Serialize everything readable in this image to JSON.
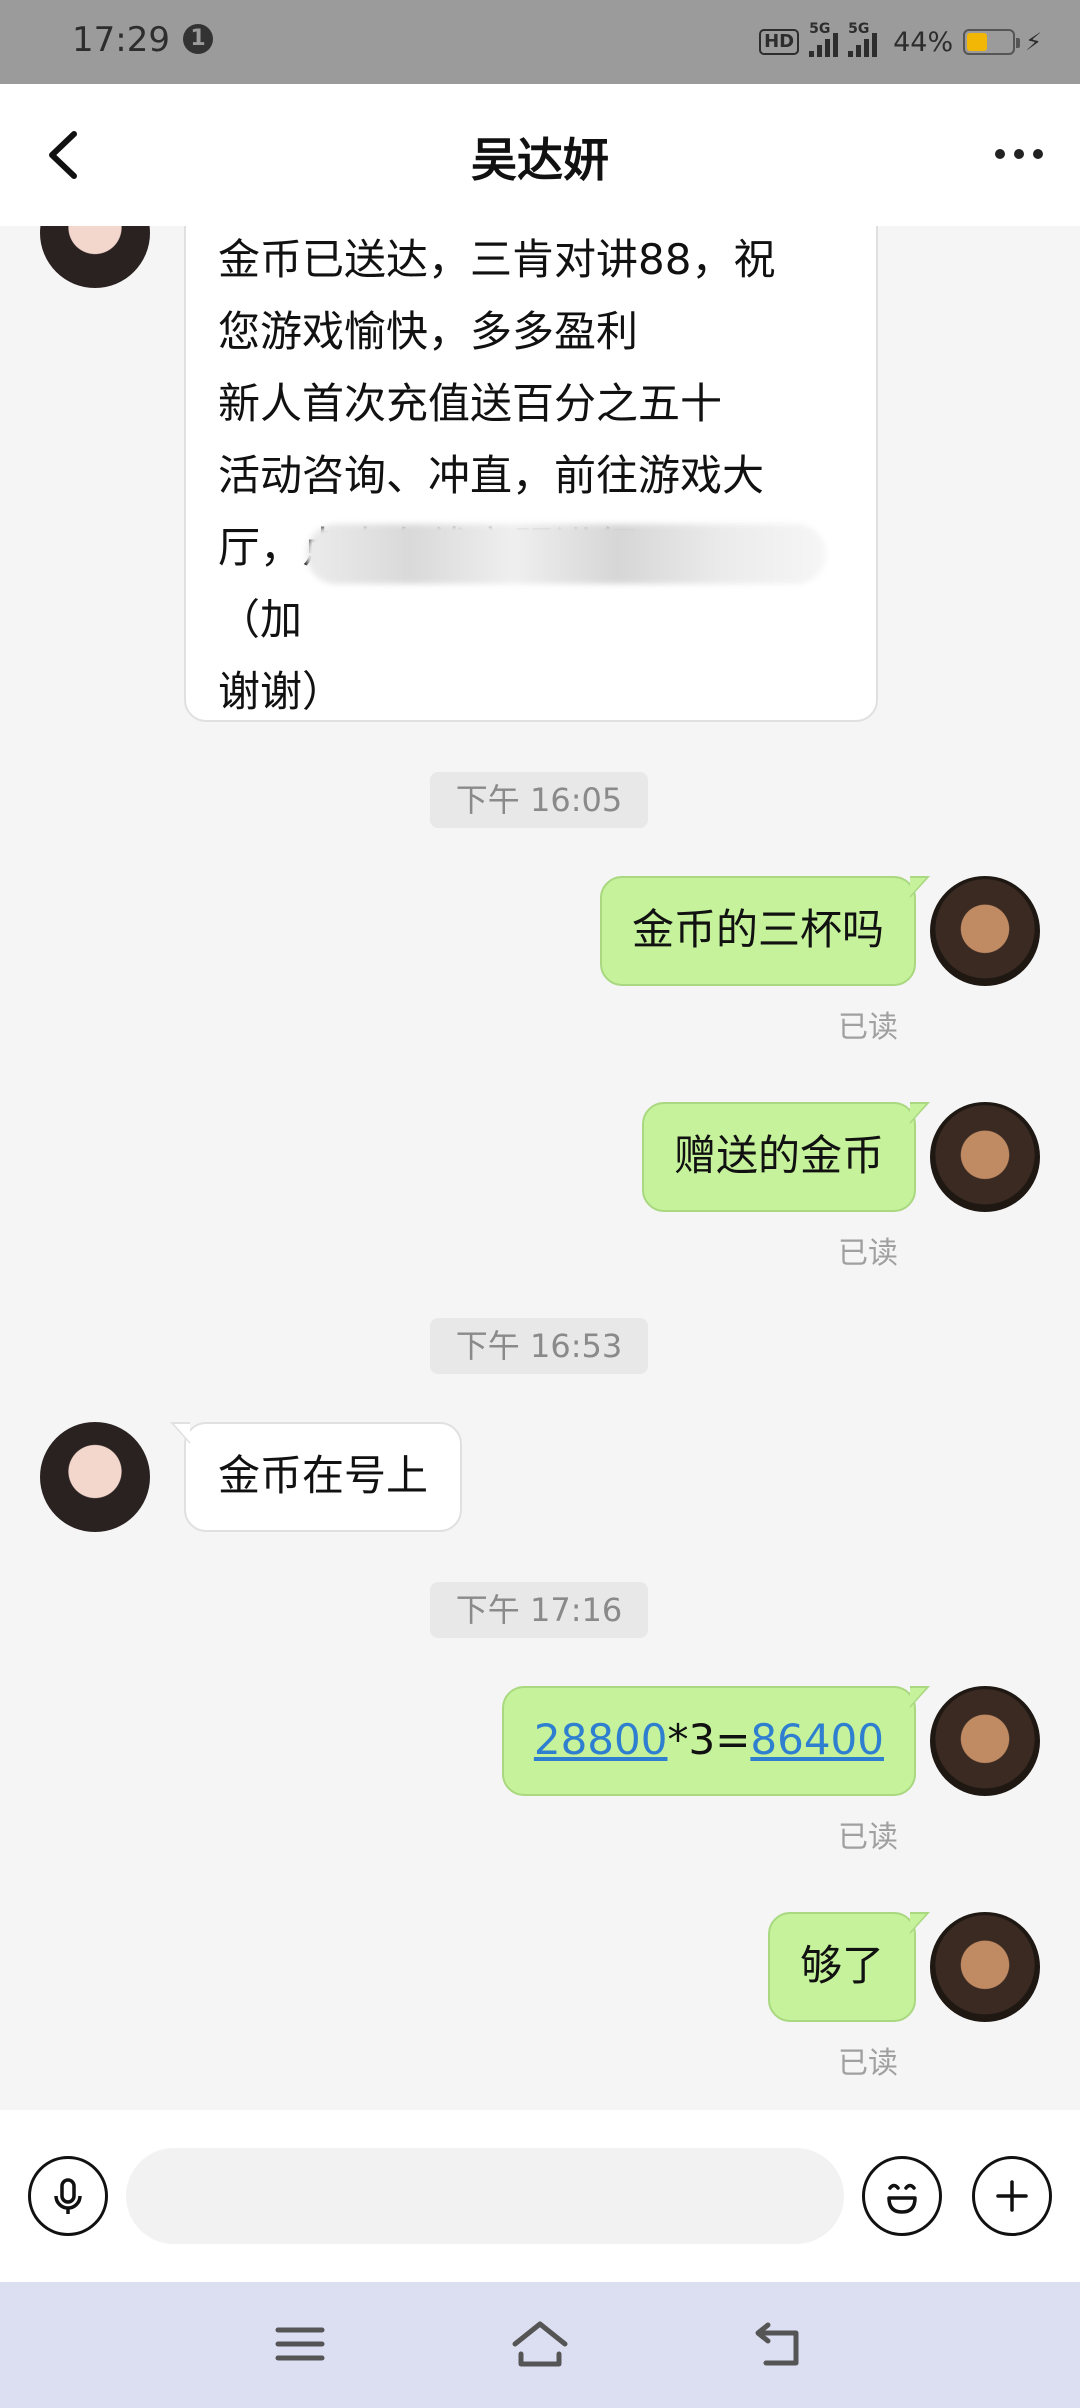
{
  "status_bar": {
    "time": "17:29",
    "notification_count": "1",
    "hd_label": "HD",
    "net1": "5G",
    "net2": "5G",
    "battery_percent": "44%",
    "battery_level": 0.44
  },
  "header": {
    "title": "吴达妍"
  },
  "messages": {
    "long_msg": {
      "lines": [
        "金币已送达，三肯对讲88，祝",
        "您游戏愉快，多多盈利",
        "新人首次充值送百分之五十",
        "活动咨询、冲直，前往游戏大",
        "厅，点击在线客服进行。",
        "（加",
        "谢谢）"
      ]
    },
    "time_1": "下午 16:05",
    "out_1": "金币的三杯吗",
    "read_1": "已读",
    "out_2": "赠送的金币",
    "read_2": "已读",
    "time_2": "下午 16:53",
    "in_1": "金币在号上",
    "time_3": "下午 17:16",
    "out_3": {
      "link_a": "28800",
      "middle": "*3=",
      "link_b": "86400"
    },
    "read_3": "已读",
    "out_4": "够了",
    "read_4": "已读"
  },
  "input": {
    "placeholder": ""
  },
  "colors": {
    "outgoing_bubble": "#c5f29b",
    "incoming_bubble": "#ffffff",
    "link": "#2f7fd1",
    "nav_bar": "#dcdff2"
  },
  "icons": {
    "back": "chevron-left-icon",
    "more": "more-dots-icon",
    "voice": "microphone-icon",
    "emoji": "emoji-icon",
    "plus": "plus-icon",
    "nav_menu": "menu-icon",
    "nav_home": "home-icon",
    "nav_back": "back-arrow-icon"
  }
}
